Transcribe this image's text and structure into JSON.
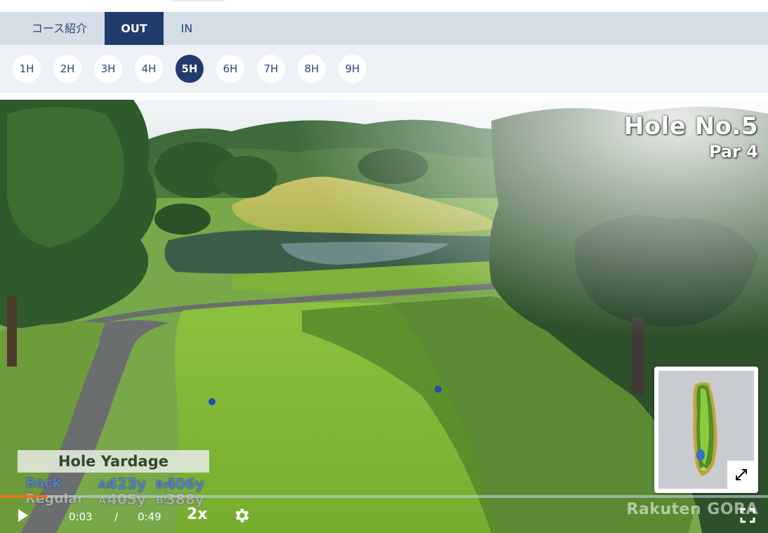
{
  "tabs": [
    {
      "label": "コース紹介",
      "active": false
    },
    {
      "label": "OUT",
      "active": true
    },
    {
      "label": "IN",
      "active": false
    }
  ],
  "holes": [
    {
      "label": "1H",
      "active": false
    },
    {
      "label": "2H",
      "active": false
    },
    {
      "label": "3H",
      "active": false
    },
    {
      "label": "4H",
      "active": false
    },
    {
      "label": "5H",
      "active": true
    },
    {
      "label": "6H",
      "active": false
    },
    {
      "label": "7H",
      "active": false
    },
    {
      "label": "8H",
      "active": false
    },
    {
      "label": "9H",
      "active": false
    }
  ],
  "video": {
    "hole_title": "Hole No.5",
    "par": "Par 4",
    "yardage": {
      "heading": "Hole Yardage",
      "back_label": "Back",
      "back_a_prefix": "A:",
      "back_a": "423y",
      "back_b_prefix": "B:",
      "back_b": "406y",
      "regular_label": "Regular",
      "regular_a_prefix": "A:",
      "regular_a": "405y",
      "regular_b_prefix": "B:",
      "regular_b": "388y"
    },
    "brand": "Rakuten GORA",
    "current_time": "0:03",
    "time_separator": "/",
    "duration": "0:49",
    "progress_fraction": 0.061,
    "speed": "2x"
  },
  "colors": {
    "accent": "#213b6d",
    "tab_bar": "#d5dde6",
    "progress": "#e8751a"
  },
  "icons": {
    "play": "play-icon",
    "settings": "gear-icon",
    "fullscreen": "fullscreen-icon",
    "expand": "expand-arrows-icon"
  }
}
